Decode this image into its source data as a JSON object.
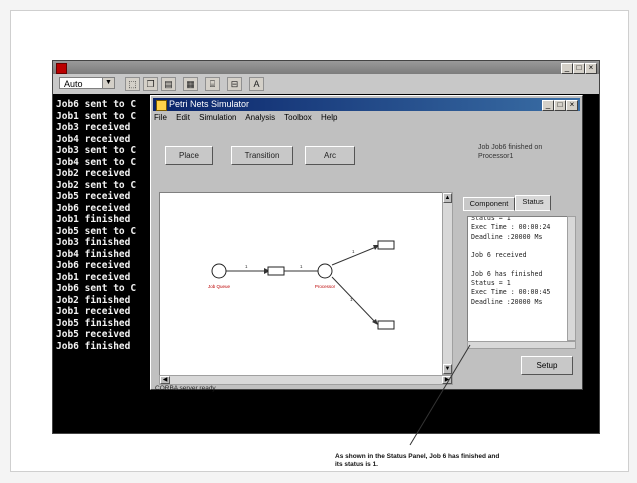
{
  "console": {
    "title": "",
    "font_select": "Auto",
    "toolbar_icons": [
      "copy-icon",
      "paste-icon",
      "properties-icon",
      "background-icon",
      "font-icon"
    ],
    "lines": [
      "Job6 sent to C",
      "Job1 sent to C",
      "Job3 received",
      "Job4 received",
      "Job3 sent to C",
      "Job4 sent to C",
      "Job2 received",
      "Job2 sent to C",
      "Job5 received",
      "Job6 received",
      "Job1 finished",
      "Job5 sent to C",
      "Job3 finished",
      "Job4 finished",
      "Job6 received",
      "Job1 received",
      "Job6 sent to C",
      "Job2 finished",
      "Job1 received",
      "Job5 finished",
      "Job5 received",
      "Job6 finished"
    ]
  },
  "simulator": {
    "title": "Petri Nets Simulator",
    "menu": [
      "File",
      "Edit",
      "Simulation",
      "Analysis",
      "Toolbox",
      "Help"
    ],
    "buttons": {
      "place": "Place",
      "transition": "Transition",
      "arc": "Arc"
    },
    "message": "Job Job6 finished on Processor1",
    "tabs": [
      "Component",
      "Status"
    ],
    "active_tab": "Status",
    "status_lines": [
      "Status = 1",
      "Exec Time : 00:00:24",
      "Deadline :20000 Ms",
      "",
      "Job 6 received",
      "",
      "Job 6 has finished",
      "Status = 1",
      "Exec Time : 00:00:45",
      "Deadline :20000 Ms"
    ],
    "setup_label": "Setup",
    "statusbar": "CORBA server ready",
    "net": {
      "place_left": "Job Queue",
      "place_mid": "Processor",
      "arc_labels": [
        "1",
        "1",
        "1",
        "1"
      ]
    }
  },
  "caption": "As shown in the Status Panel, Job 6 has finished and its status is 1."
}
